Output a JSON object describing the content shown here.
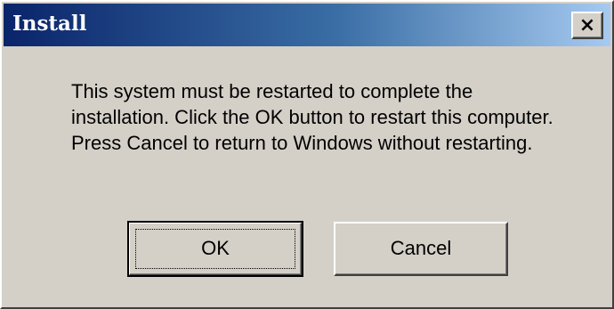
{
  "window": {
    "title": "Install",
    "close_glyph": "×"
  },
  "message": "This system must be restarted to complete the installation. Click the OK button to restart this computer. Press Cancel to return to Windows without restarting.",
  "buttons": {
    "ok_label": "OK",
    "cancel_label": "Cancel"
  },
  "colors": {
    "titlebar_start": "#0a246a",
    "titlebar_end": "#a6caf0",
    "face": "#d4d0c8"
  }
}
